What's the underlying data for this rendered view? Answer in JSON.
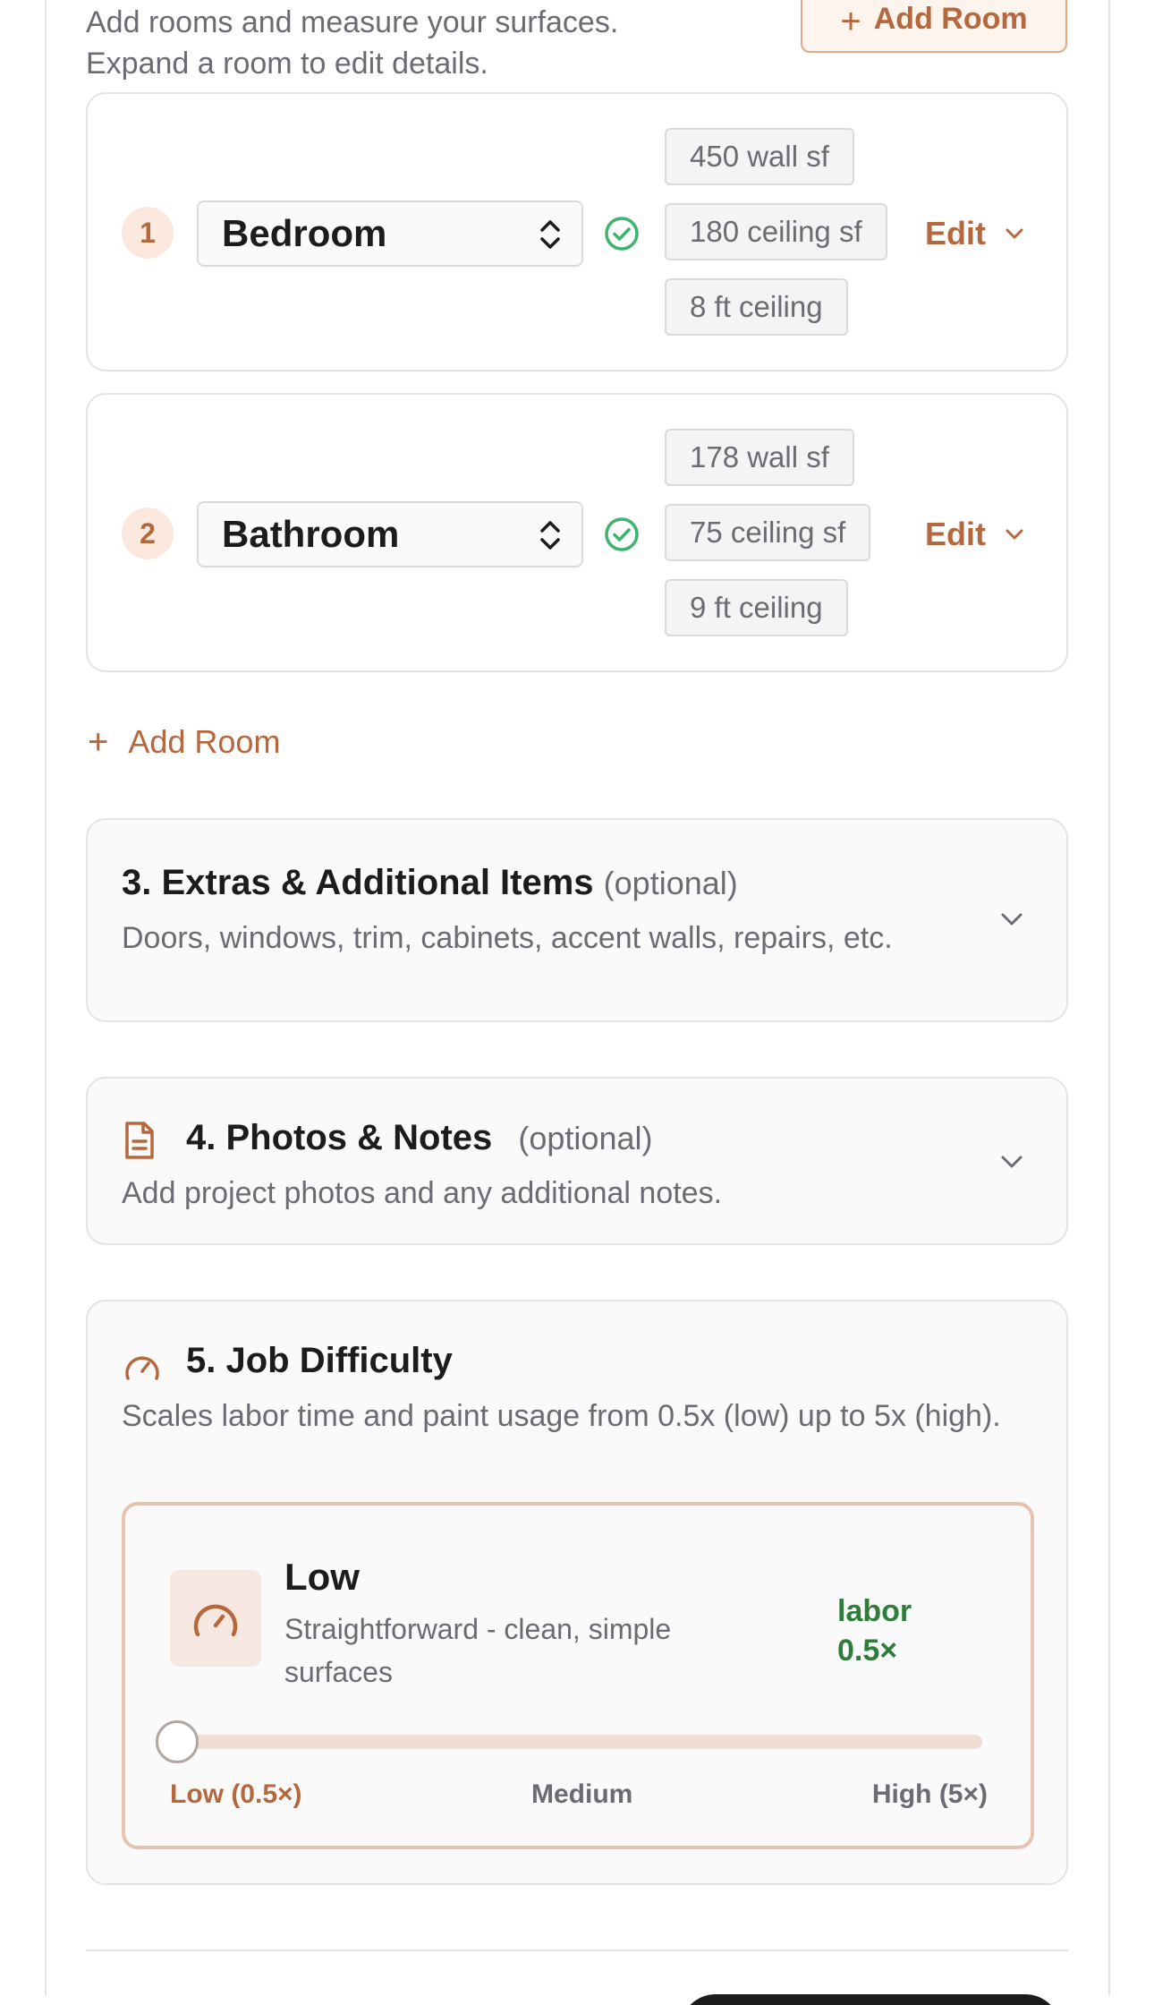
{
  "intro": {
    "line1": "Add rooms and measure your surfaces.",
    "line2": "Expand a room to edit details."
  },
  "header_add_room_label": "Add Room",
  "rooms": [
    {
      "number": "1",
      "name": "Bedroom",
      "wall": "450 wall sf",
      "ceiling_area": "180 ceiling sf",
      "ceiling_height": "8 ft ceiling",
      "edit_label": "Edit"
    },
    {
      "number": "2",
      "name": "Bathroom",
      "wall": "178 wall sf",
      "ceiling_area": "75 ceiling sf",
      "ceiling_height": "9 ft ceiling",
      "edit_label": "Edit"
    }
  ],
  "add_room_link_label": "Add Room",
  "sections": {
    "extras": {
      "title": "3. Extras & Additional Items",
      "optional": "(optional)",
      "description": "Doors, windows, trim, cabinets, accent walls, repairs, etc."
    },
    "photos": {
      "title": "4. Photos & Notes",
      "optional": "(optional)",
      "description": "Add project photos and any additional notes."
    },
    "difficulty": {
      "title": "5. Job Difficulty",
      "description": "Scales labor time and paint usage from 0.5x (low) up to 5x (high).",
      "level_name": "Low",
      "level_description": "Straightforward - clean, simple surfaces",
      "labor_label": "labor",
      "labor_value": "0.5×",
      "slider": {
        "value_fraction": 0.0,
        "label_low": "Low (0.5×)",
        "label_mid": "Medium",
        "label_high": "High (5×)"
      }
    }
  },
  "colors": {
    "accent": "#b5683d",
    "success": "#3cb46e",
    "labor_green": "#2f7d3a"
  },
  "icons": [
    "plus-icon",
    "updown-chevron-icon",
    "check-circle-icon",
    "chevron-down-icon",
    "document-icon",
    "gauge-icon"
  ]
}
